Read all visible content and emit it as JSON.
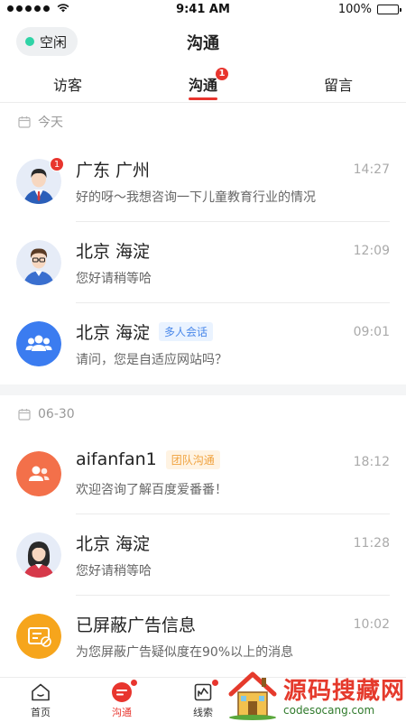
{
  "status_bar": {
    "time": "9:41 AM",
    "battery": "100%"
  },
  "header": {
    "status_label": "空闲",
    "title": "沟通"
  },
  "tabs": [
    {
      "label": "访客"
    },
    {
      "label": "沟通",
      "badge": "1",
      "active": true
    },
    {
      "label": "留言"
    }
  ],
  "sections": [
    {
      "date": "今天",
      "items": [
        {
          "name": "广东 广州",
          "time": "14:27",
          "message": "好的呀～我想咨询一下儿童教育行业的情况",
          "unread": "1"
        },
        {
          "name": "北京 海淀",
          "time": "12:09",
          "message": "您好请稍等哈"
        },
        {
          "name": "北京 海淀",
          "tag": "多人会话",
          "time": "09:01",
          "message": "请问，您是自适应网站吗？"
        }
      ]
    },
    {
      "date": "06-30",
      "items": [
        {
          "name": "aifanfan1",
          "tag": "团队沟通",
          "time": "18:12",
          "message": "欢迎咨询了解百度爱番番！"
        },
        {
          "name": "北京 海淀",
          "time": "11:28",
          "message": "您好请稍等哈"
        },
        {
          "name": "已屏蔽广告信息",
          "time": "10:02",
          "message": "为您屏蔽广告疑似度在90%以上的消息"
        }
      ]
    }
  ],
  "bottom_nav": [
    {
      "label": "首页",
      "icon": "home-icon"
    },
    {
      "label": "沟通",
      "icon": "chat-icon",
      "active": true
    },
    {
      "label": "线索",
      "icon": "leads-icon"
    }
  ],
  "watermark": {
    "title": "源码搜藏网",
    "subtitle": "codesocang.com"
  },
  "colors": {
    "accent": "#e8352e",
    "online": "#2fd3a6",
    "group_avatar": "#3b7cf0",
    "team_avatar": "#f3704a",
    "blocked_avatar": "#f6a51c"
  }
}
